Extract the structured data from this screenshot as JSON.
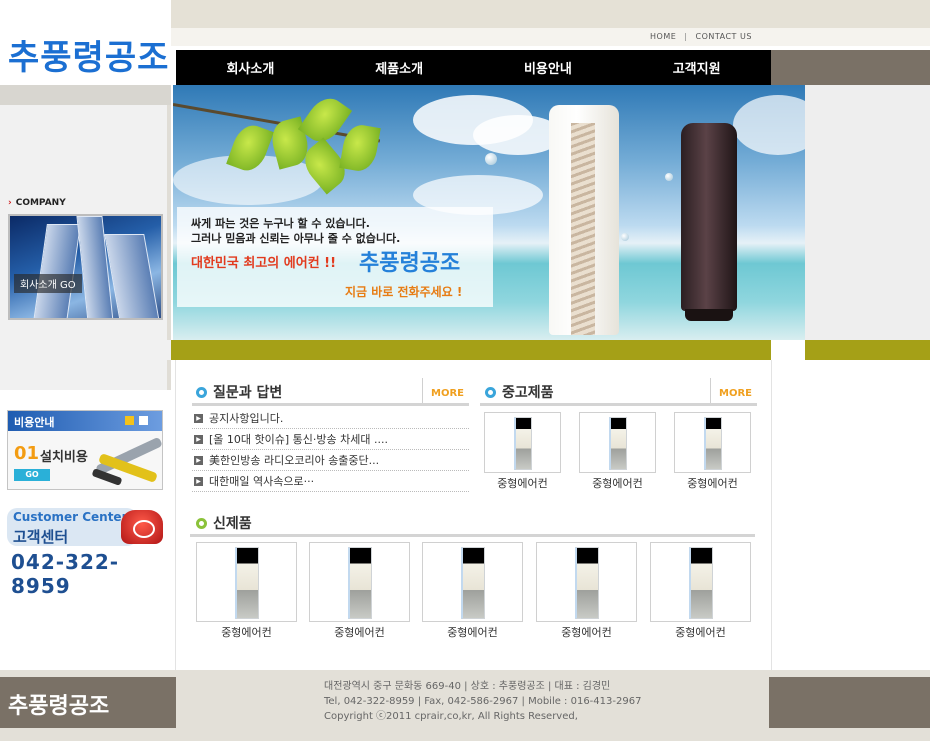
{
  "brand": {
    "logo": "추풍령공조"
  },
  "top_links": {
    "home": "HOME",
    "separator": "|",
    "contact": "CONTACT US"
  },
  "nav": {
    "items": [
      "회사소개",
      "제품소개",
      "비용안내",
      "고객지원"
    ]
  },
  "banner": {
    "line1": "싸게 파는 것은 누구나 할 수 있습니다.",
    "line2": "그러나 믿음과 신뢰는 아무나 줄 수 없습니다.",
    "line3": "대한민국 최고의 에어컨 !!",
    "brand": "추풍령공조",
    "line4": "지금 바로 전화주세요 !"
  },
  "sidebar": {
    "company_label": "COMPANY",
    "company_go": "회사소개 GO",
    "cost_title": "비용안내",
    "cost_number": "01",
    "cost_label": "설치비용",
    "cost_go": "GO",
    "cs_en": "Customer Center",
    "cs_kr": "고객센터",
    "cs_phone": "042-322-8959"
  },
  "qa": {
    "title": "질문과 답변",
    "more": "MORE",
    "items": [
      "공지사항입니다.",
      "[올 10대 핫이슈] 통신·방송 차세대 ....",
      "美한인방송 라디오코리아 송출중단...",
      "대한매일 역사속으로···"
    ]
  },
  "used": {
    "title": "중고제품",
    "more": "MORE",
    "items": [
      "중형에어컨",
      "중형에어컨",
      "중형에어컨"
    ]
  },
  "new_products": {
    "title": "신제품",
    "items": [
      "중형에어컨",
      "중형에어컨",
      "중형에어컨",
      "중형에어컨",
      "중형에어컨"
    ]
  },
  "footer": {
    "logo": "추풍령공조",
    "line1": "대전광역시 중구 문화동 669-40 | 상호 : 추풍령공조 | 대표 : 김경민",
    "line2": "Tel, 042-322-8959 | Fax, 042-586-2967 | Mobile : 016-413-2967",
    "line3": "Copyright ⓒ2011 cprair,co,kr, All Rights Reserved,"
  },
  "colors": {
    "nav_bg": "#000000",
    "logo_blue": "#1b6fd2",
    "olive": "#a5a017",
    "accent_orange": "#f0a020"
  }
}
